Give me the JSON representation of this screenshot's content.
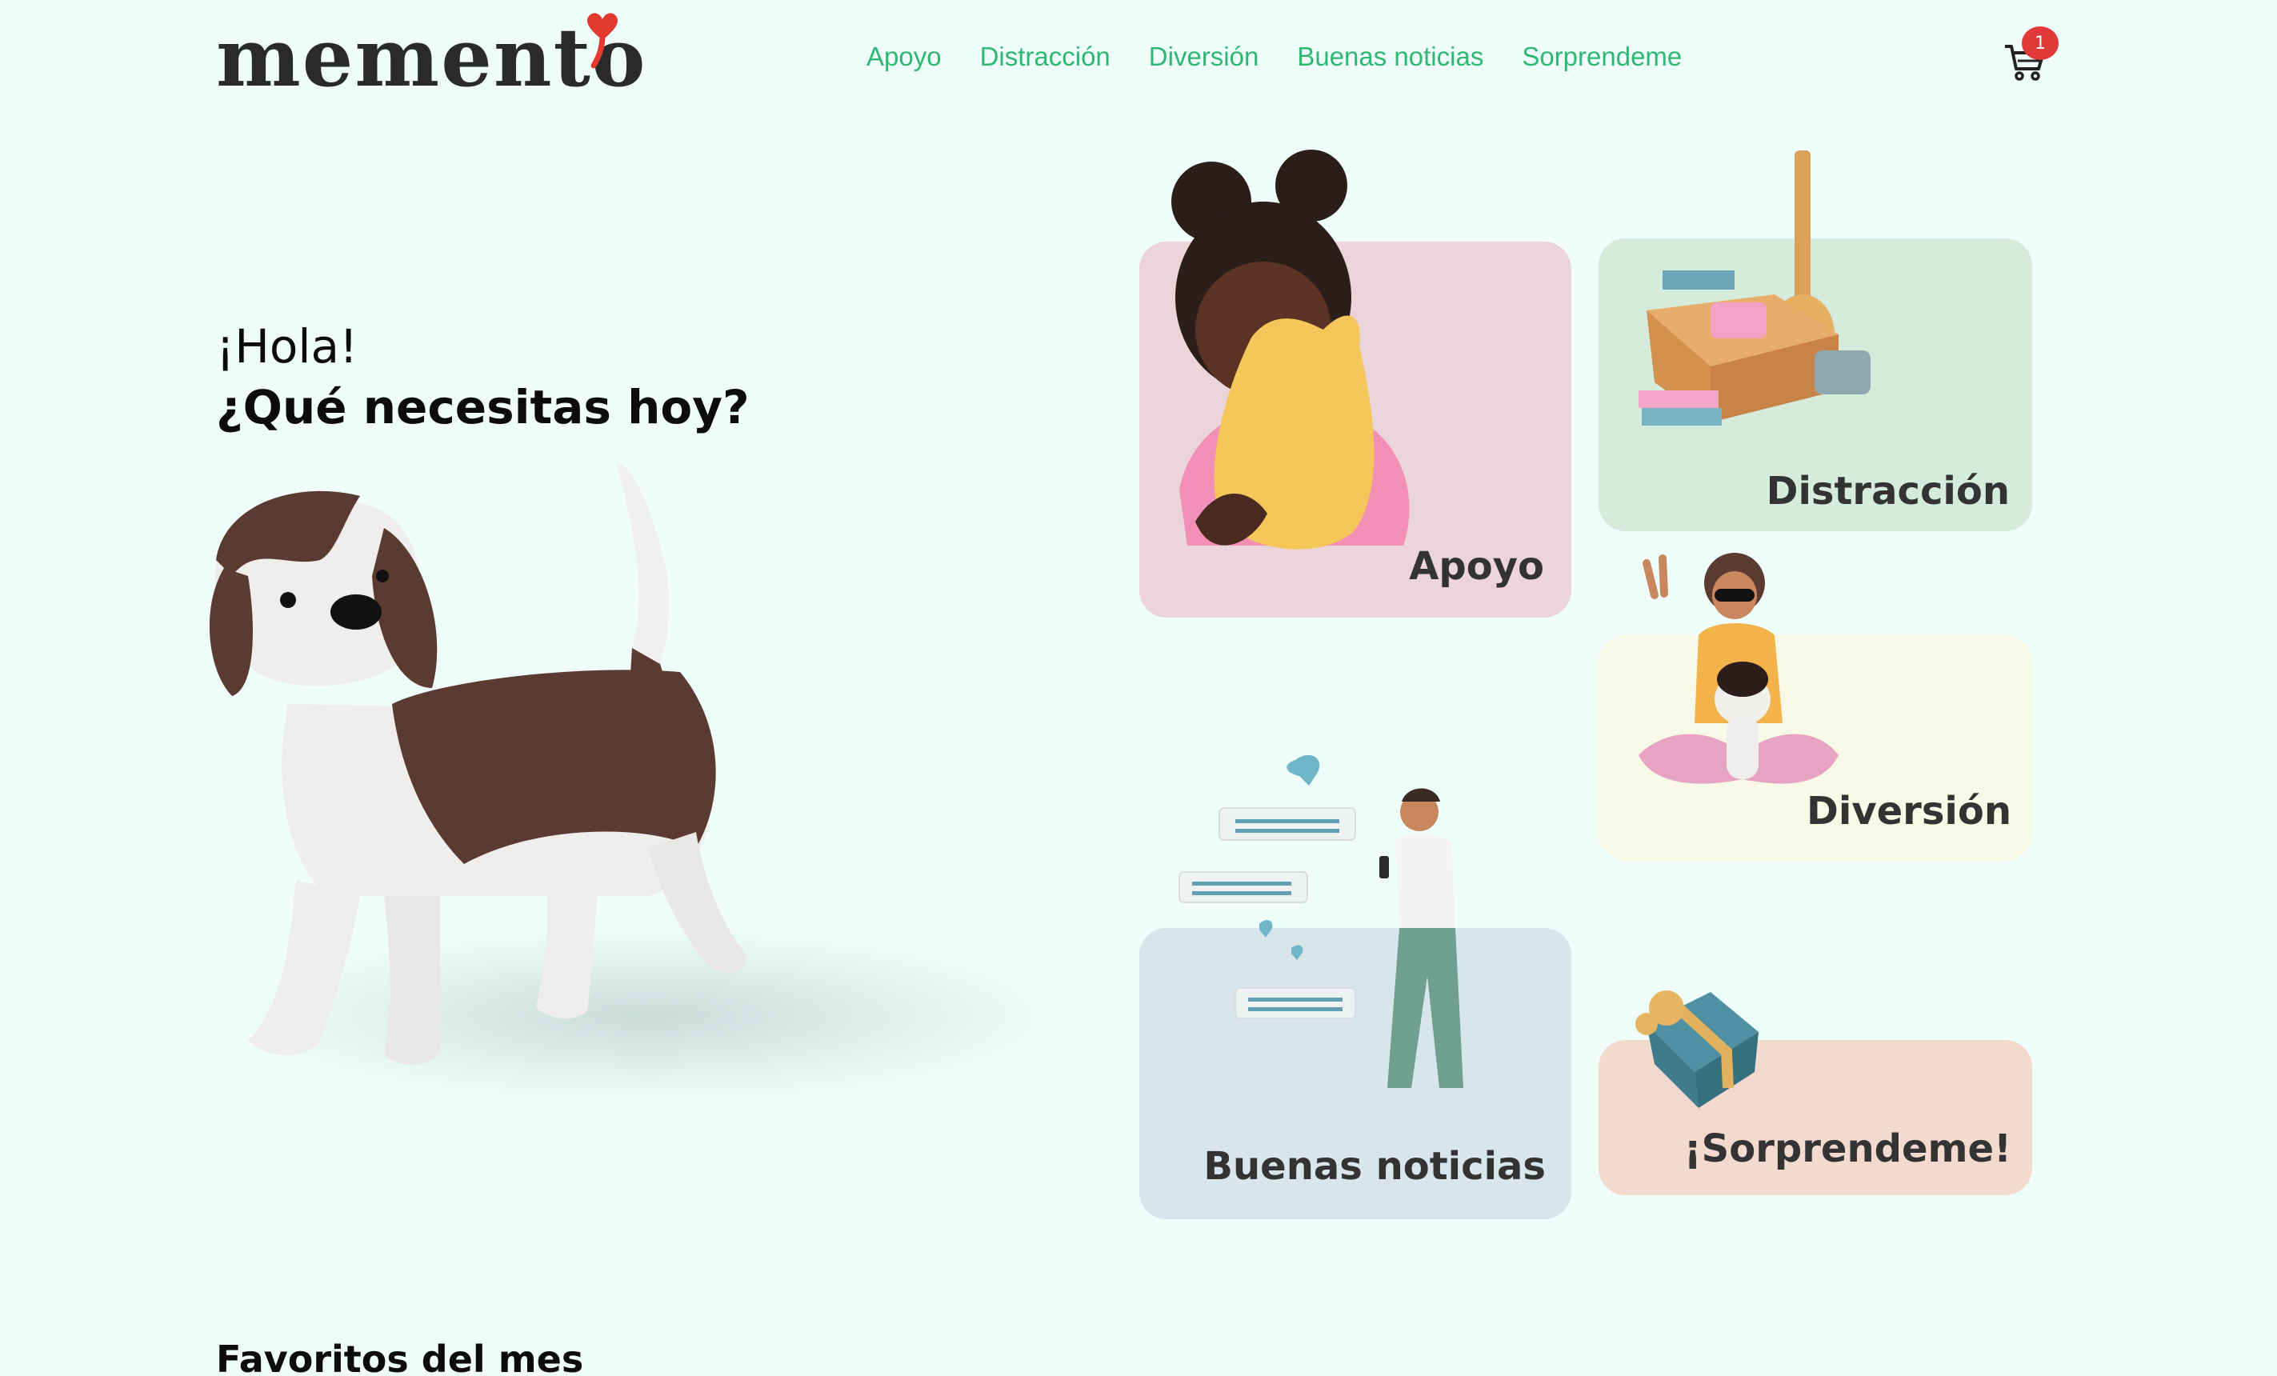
{
  "brand": {
    "name": "memento",
    "heart_color": "#e23a2e"
  },
  "nav": {
    "items": [
      "Apoyo",
      "Distracción",
      "Diversión",
      "Buenas noticias",
      "Sorprendeme"
    ],
    "color": "#2eb872"
  },
  "cart": {
    "icon": "cart-icon",
    "count": "1",
    "badge_color": "#e23a3a"
  },
  "hero": {
    "line1": "¡Hola!",
    "line2": "¿Qué necesitas hoy?"
  },
  "cards": {
    "apoyo": {
      "label": "Apoyo",
      "bg": "#ecd5da"
    },
    "distraccion": {
      "label": "Distracción",
      "bg": "#d5ebdb"
    },
    "diversion": {
      "label": "Diversión",
      "bg": "#f8f9e7"
    },
    "buenas": {
      "label": "Buenas noticias",
      "bg": "#d8e5ea"
    },
    "sorprendeme": {
      "label": "¡Sorprendeme!",
      "bg": "#f4d9ce"
    }
  },
  "section": {
    "favoritos_title": "Favoritos del mes"
  }
}
